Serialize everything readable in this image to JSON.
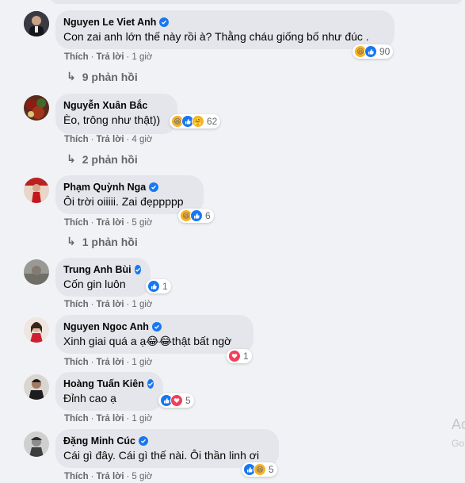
{
  "comments": [
    {
      "name": "Nguyen Le Viet Anh",
      "verified": true,
      "text": "Con zai anh lớn thế này rồi à? Thằng cháu giống bố như đúc .",
      "like": "Thích",
      "reply": "Trả lời",
      "time": "1 giờ",
      "reactions": [
        "haha",
        "like"
      ],
      "reaction_count": "90",
      "replies": "9 phản hồi"
    },
    {
      "name": "Nguyễn Xuân Bắc",
      "verified": false,
      "text": "Èo, trông như thật))",
      "like": "Thích",
      "reply": "Trả lời",
      "time": "4 giờ",
      "reactions": [
        "haha",
        "like",
        "care"
      ],
      "reaction_count": "62",
      "replies": "2 phản hồi"
    },
    {
      "name": "Phạm Quỳnh Nga",
      "verified": true,
      "text": "Ôi trời oiiiii. Zai đẹppppp",
      "like": "Thích",
      "reply": "Trả lời",
      "time": "5 giờ",
      "reactions": [
        "haha",
        "like"
      ],
      "reaction_count": "6",
      "replies": "1 phản hồi"
    },
    {
      "name": "Trung Anh Bùi",
      "verified": true,
      "text": "Cốn gin luôn",
      "like": "Thích",
      "reply": "Trả lời",
      "time": "1 giờ",
      "reactions": [
        "like"
      ],
      "reaction_count": "1"
    },
    {
      "name": "Nguyen Ngoc Anh",
      "verified": true,
      "text": "Xinh giai quá a ạ😂😂thật bất ngờ",
      "like": "Thích",
      "reply": "Trả lời",
      "time": "1 giờ",
      "reactions": [
        "love"
      ],
      "reaction_count": "1"
    },
    {
      "name": "Hoàng Tuấn Kiên",
      "verified": true,
      "text": "Đỉnh cao ạ",
      "like": "Thích",
      "reply": "Trả lời",
      "time": "1 giờ",
      "reactions": [
        "like",
        "love"
      ],
      "reaction_count": "5"
    },
    {
      "name": "Đặng Minh Cúc",
      "verified": true,
      "text": "Cái gì đây. Cái gì thế nài. Ôi thần linh ơi",
      "like": "Thích",
      "reply": "Trả lời",
      "time": "5 giờ",
      "reactions": [
        "like",
        "haha"
      ],
      "reaction_count": "5"
    }
  ],
  "watermark": {
    "line1": "Ac",
    "line2": "Go"
  },
  "colors": {
    "bubble": "#e4e6eb",
    "background": "#f0f2f5",
    "meta_text": "#65676b",
    "verified": "#1877f2",
    "like": "#1877f2",
    "haha": "#f7b125",
    "love": "#f33e58"
  }
}
